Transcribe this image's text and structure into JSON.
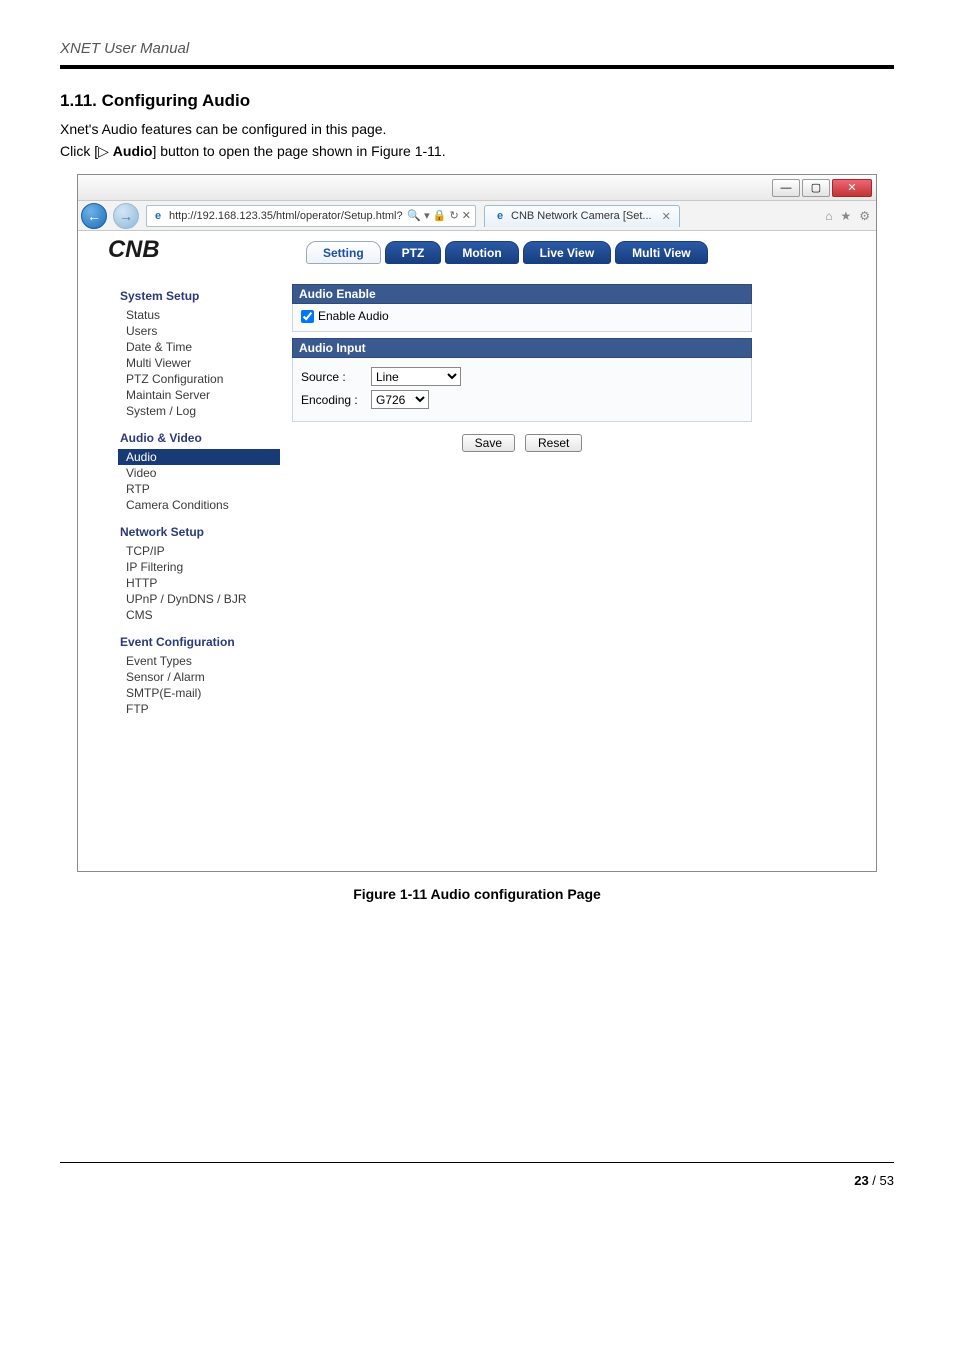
{
  "doc": {
    "header": "XNET User Manual",
    "section_num": "1.11.",
    "section_title": "Configuring Audio",
    "para1": "Xnet's Audio features can be configured in this page.",
    "para2_pre": "Click [▷ ",
    "para2_bold": "Audio",
    "para2_post": "] button to open the page shown in Figure 1-11.",
    "figure_caption": "Figure 1-11 Audio configuration Page",
    "page_cur": "23",
    "page_sep": " / ",
    "page_total": "53"
  },
  "win": {
    "min": "—",
    "max": "▢",
    "close": "✕",
    "back": "←",
    "fwd": "→",
    "url": "http://192.168.123.35/html/operator/Setup.html?",
    "url_icons": "🔍 ▾  🔒 ↻ ✕",
    "tab_title": "CNB Network Camera [Set...",
    "tab_x": "✕",
    "home_icon": "⌂",
    "star_icon": "★",
    "gear_icon": "⚙"
  },
  "brand": "CNB",
  "topnav": {
    "setting": "Setting",
    "ptz": "PTZ",
    "motion": "Motion",
    "live": "Live View",
    "multi": "Multi View"
  },
  "sidebar": {
    "g1": "System Setup",
    "g1_items": [
      "Status",
      "Users",
      "Date & Time",
      "Multi Viewer",
      "PTZ Configuration",
      "Maintain Server",
      "System / Log"
    ],
    "g2": "Audio & Video",
    "g2_items": [
      "Audio",
      "Video",
      "RTP",
      "Camera Conditions"
    ],
    "g3": "Network Setup",
    "g3_items": [
      "TCP/IP",
      "IP Filtering",
      "HTTP",
      "UPnP / DynDNS / BJR",
      "CMS"
    ],
    "g4": "Event Configuration",
    "g4_items": [
      "Event Types",
      "Sensor / Alarm",
      "SMTP(E-mail)",
      "FTP"
    ]
  },
  "panel": {
    "audio_enable_head": "Audio Enable",
    "enable_audio_label": "Enable Audio",
    "audio_input_head": "Audio Input",
    "source_label": "Source :",
    "source_value": "Line",
    "encoding_label": "Encoding :",
    "encoding_value": "G726",
    "save": "Save",
    "reset": "Reset"
  }
}
